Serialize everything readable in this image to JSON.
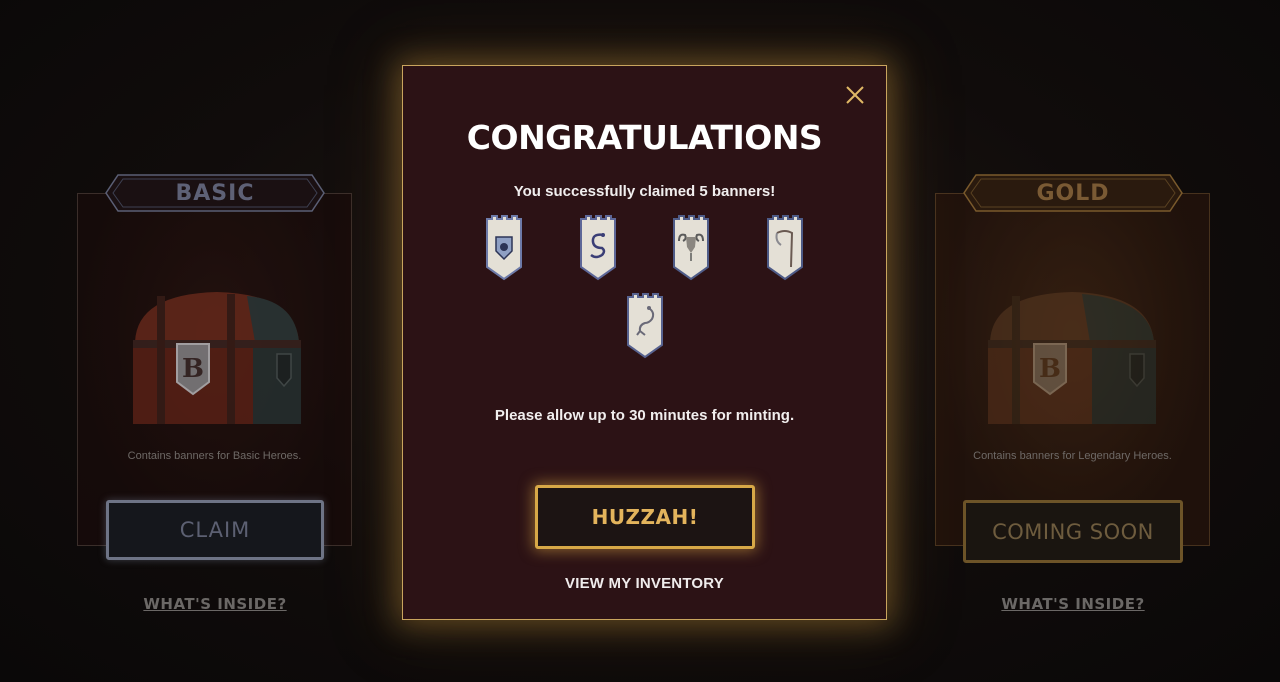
{
  "cards": {
    "basic": {
      "tier_label": "BASIC",
      "description": "Contains banners for Basic Heroes.",
      "button_label": "CLAIM",
      "link_label": "WHAT'S INSIDE?"
    },
    "gold": {
      "tier_label": "GOLD",
      "description": "Contains banners for Legendary Heroes.",
      "button_label": "COMING SOON",
      "link_label": "WHAT'S INSIDE?"
    }
  },
  "modal": {
    "title": "CONGRATULATIONS",
    "claimed_text": "You successfully claimed 5 banners!",
    "banners": [
      {
        "icon": "shield-emblem-icon",
        "trim": "#6d7aa8"
      },
      {
        "icon": "serpent-emblem-icon",
        "trim": "#5d6798"
      },
      {
        "icon": "ram-skull-emblem-icon",
        "trim": "#4f5c88"
      },
      {
        "icon": "scythe-emblem-icon",
        "trim": "#4d5a86"
      },
      {
        "icon": "scorpion-emblem-icon",
        "trim": "#57628f"
      }
    ],
    "minting_text": "Please allow up to 30 minutes for minting.",
    "primary_button": "HUZZAH!",
    "secondary_link": "VIEW MY INVENTORY",
    "close_icon": "close-icon"
  },
  "colors": {
    "accent_gold": "#d7a847",
    "modal_bg": "#2c1215",
    "basic_trim": "#6e7486"
  }
}
